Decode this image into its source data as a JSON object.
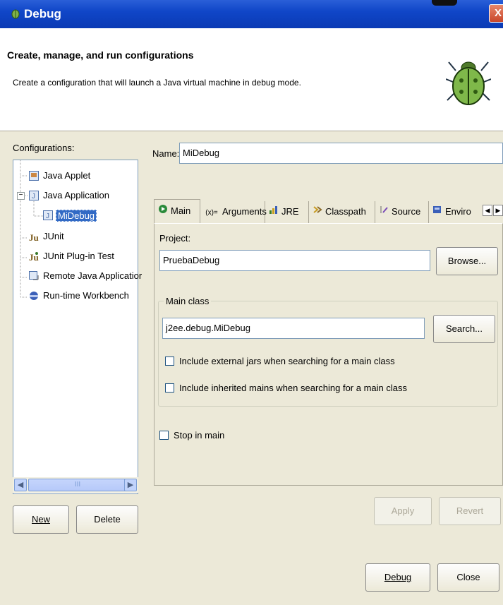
{
  "window": {
    "title": "Debug",
    "close_label": "X"
  },
  "header": {
    "title": "Create, manage, and run configurations",
    "description": "Create a configuration that will launch a Java virtual machine in debug mode."
  },
  "configurations": {
    "label": "Configurations:",
    "items": [
      {
        "label": "Java Applet",
        "icon": "java-applet-icon"
      },
      {
        "label": "Java Application",
        "icon": "java-application-icon",
        "expanded": true
      },
      {
        "label": "MiDebug",
        "icon": "java-config-icon",
        "selected": true
      },
      {
        "label": "JUnit",
        "icon": "junit-icon"
      },
      {
        "label": "JUnit Plug-in Test",
        "icon": "junit-plugin-icon"
      },
      {
        "label": "Remote Java Applicatior",
        "icon": "remote-java-icon"
      },
      {
        "label": "Run-time Workbench",
        "icon": "runtime-workbench-icon"
      }
    ],
    "scroll_thumb_grip": "III"
  },
  "buttons": {
    "new": "New",
    "delete": "Delete",
    "apply": "Apply",
    "revert": "Revert",
    "debug": "Debug",
    "close": "Close"
  },
  "name_field": {
    "label": "Name:",
    "value": "MiDebug"
  },
  "tabs": [
    {
      "label": "Main",
      "icon": "main-tab-icon",
      "active": true
    },
    {
      "label": "Arguments",
      "icon": "arguments-tab-icon"
    },
    {
      "label": "JRE",
      "icon": "jre-tab-icon"
    },
    {
      "label": "Classpath",
      "icon": "classpath-tab-icon"
    },
    {
      "label": "Source",
      "icon": "source-tab-icon"
    },
    {
      "label": "Enviro",
      "icon": "environment-tab-icon"
    }
  ],
  "tab_icon_glyphs": {
    "arguments": "(x)="
  },
  "project": {
    "label": "Project:",
    "value": "PruebaDebug",
    "browse_label": "Browse..."
  },
  "main_class": {
    "group_label": "Main class",
    "value": "j2ee.debug.MiDebug",
    "search_label": "Search...",
    "include_external_jars": {
      "label": "Include external jars when searching for a main class",
      "checked": false
    },
    "include_inherited_mains": {
      "label": "Include inherited mains when searching for a main class",
      "checked": false
    }
  },
  "stop_in_main": {
    "label": "Stop in main",
    "checked": false
  },
  "colors": {
    "title_bar": "#0a3ab4",
    "selection": "#316ac5",
    "dialog_bg": "#ece9d8"
  }
}
